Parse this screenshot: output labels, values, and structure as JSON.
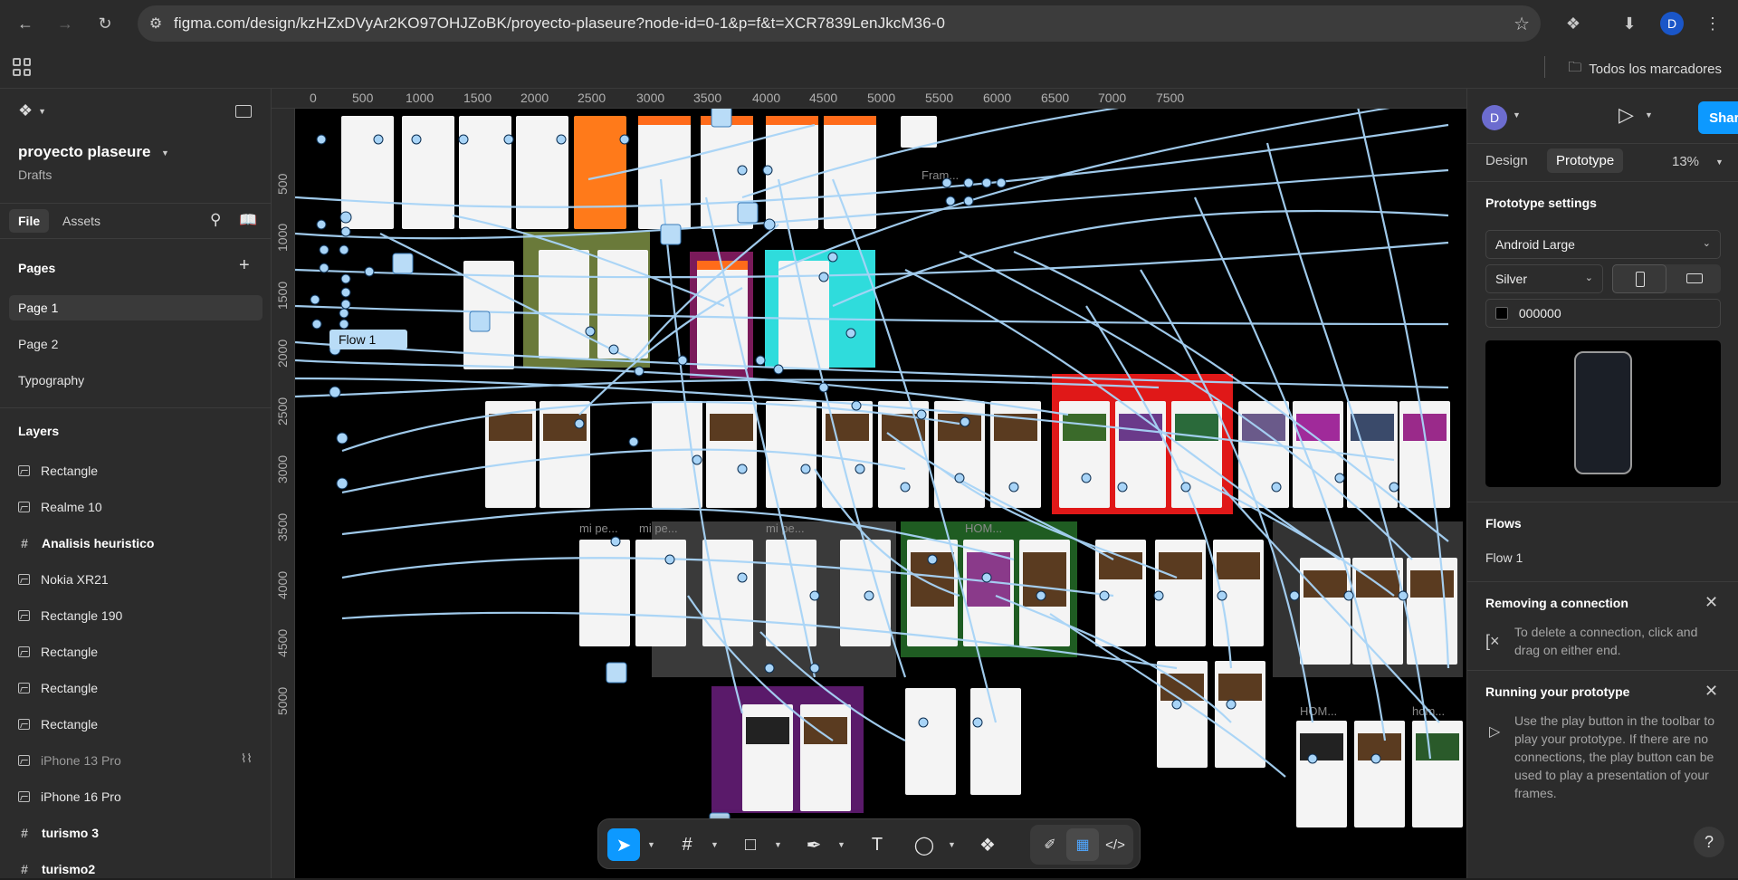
{
  "browser": {
    "url": "figma.com/design/kzHZxDVyAr2KO97OHJZoBK/proyecto-plaseure?node-id=0-1&p=f&t=XCR7839LenJkcM36-0",
    "profile_initial": "D",
    "bookmarks_folder": "Todos los marcadores"
  },
  "left_panel": {
    "project_name": "proyecto plaseure",
    "project_location": "Drafts",
    "tabs": {
      "file": "File",
      "assets": "Assets"
    },
    "pages_title": "Pages",
    "pages": [
      {
        "label": "Page 1",
        "active": true
      },
      {
        "label": "Page 2",
        "active": false
      },
      {
        "label": "Typography",
        "active": false
      }
    ],
    "layers_title": "Layers",
    "layers": [
      {
        "label": "Rectangle",
        "icon": "image-icon"
      },
      {
        "label": "Realme 10",
        "icon": "image-icon"
      },
      {
        "label": "Analisis heuristico",
        "icon": "frame-icon"
      },
      {
        "label": "Nokia XR21",
        "icon": "image-icon"
      },
      {
        "label": "Rectangle 190",
        "icon": "image-icon"
      },
      {
        "label": "Rectangle",
        "icon": "image-icon"
      },
      {
        "label": "Rectangle",
        "icon": "image-icon"
      },
      {
        "label": "Rectangle",
        "icon": "image-icon"
      },
      {
        "label": "iPhone 13 Pro",
        "icon": "image-icon"
      },
      {
        "label": "iPhone 16 Pro",
        "icon": "image-icon"
      },
      {
        "label": "turismo 3",
        "icon": "frame-icon"
      },
      {
        "label": "turismo2",
        "icon": "frame-icon"
      }
    ]
  },
  "canvas": {
    "ruler_x": [
      "0",
      "500",
      "1000",
      "1500",
      "2000",
      "2500",
      "3000",
      "3500",
      "4000",
      "4500",
      "5000",
      "5500",
      "6000",
      "6500",
      "7000",
      "7500"
    ],
    "ruler_y": [
      "500",
      "1000",
      "1500",
      "2000",
      "2500",
      "3000",
      "3500",
      "4000",
      "4500",
      "5000"
    ],
    "flow_label": "Flow 1",
    "frame_labels": [
      "Fram...",
      "mi pe...",
      "mi pe...",
      "mi pe...",
      "HOM...",
      "HOM...",
      "hom..."
    ]
  },
  "right_panel": {
    "user_initial": "D",
    "share_label": "Share",
    "tab_design": "Design",
    "tab_prototype": "Prototype",
    "zoom": "13%",
    "prototype_settings_title": "Prototype settings",
    "device": "Android Large",
    "model_color": "Silver",
    "background_color": "000000",
    "flows_title": "Flows",
    "flow_item": "Flow 1",
    "removing_title": "Removing a connection",
    "removing_text": "To delete a connection, click and drag on either end.",
    "running_title": "Running your prototype",
    "running_text": "Use the play button in the toolbar to play your prototype. If there are no connections, the play button can be used to play a presentation of your frames."
  }
}
